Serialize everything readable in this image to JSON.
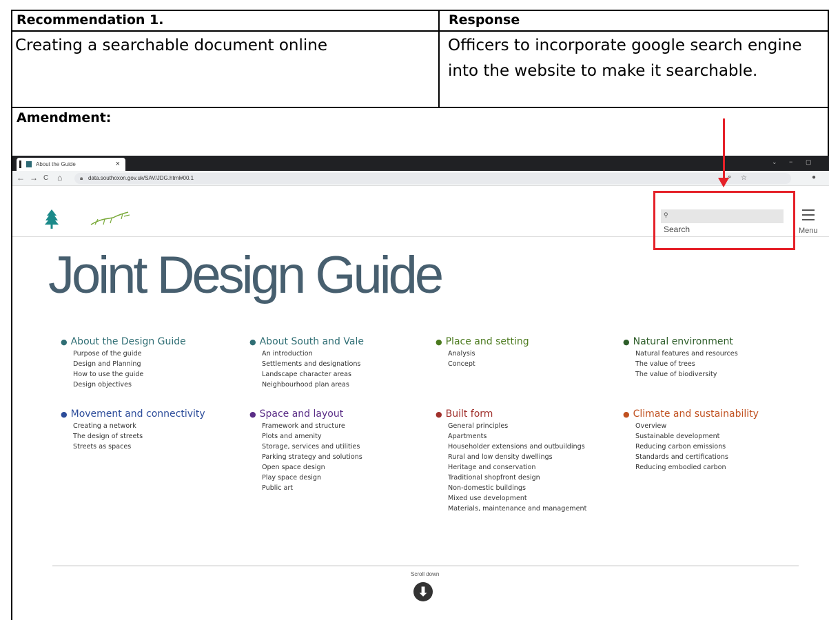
{
  "table": {
    "header_left": "Recommendation 1.",
    "header_right": "Response",
    "recommendation": "Creating a searchable document online",
    "response": "Officers to incorporate google search engine into the website to make it searchable.",
    "amendment_label": "Amendment:"
  },
  "browser": {
    "tab_title": "About the Guide",
    "tab_close": "×",
    "url": "data.southoxon.gov.uk/SAV/JDG.html#00.1",
    "back": "←",
    "forward": "→",
    "reload": "C",
    "home": "⌂",
    "share_icon": "⇗",
    "star_icon": "☆",
    "profile_icon": "●",
    "win_chevron": "⌄",
    "win_min": "−",
    "win_max": "▢"
  },
  "site": {
    "search_label": "Search",
    "search_icon": "⚲",
    "menu_label": "Menu",
    "title": "Joint Design Guide",
    "scroll_label": "Scroll down",
    "scroll_arrow": "⬇",
    "sections": [
      {
        "title": "About the Design Guide",
        "color": "#2f6e74",
        "items": [
          "Purpose of the guide",
          "Design and Planning",
          "How to use the guide",
          "Design objectives"
        ]
      },
      {
        "title": "About South and Vale",
        "color": "#2f6e74",
        "items": [
          "An introduction",
          "Settlements and designations",
          "Landscape character areas",
          "Neighbourhood plan areas"
        ]
      },
      {
        "title": "Place and setting",
        "color": "#4b7a1e",
        "items": [
          "Analysis",
          "Concept"
        ]
      },
      {
        "title": "Natural environment",
        "color": "#2e5e2a",
        "items": [
          "Natural features and resources",
          "The value of trees",
          "The value of biodiversity"
        ]
      },
      {
        "title": "Movement and connectivity",
        "color": "#2c4c9a",
        "items": [
          "Creating a network",
          "The design of streets",
          "Streets as spaces"
        ]
      },
      {
        "title": "Space and layout",
        "color": "#5a2d86",
        "items": [
          "Framework and structure",
          "Plots and amenity",
          "Storage, services and utilities",
          "Parking strategy and solutions",
          "Open space design",
          "Play space design",
          "Public art"
        ]
      },
      {
        "title": "Built form",
        "color": "#a0302c",
        "items": [
          "General principles",
          "Apartments",
          "Householder extensions and outbuildings",
          "Rural and low density dwellings",
          "Heritage and conservation",
          "Traditional shopfront design",
          "Non-domestic buildings",
          "Mixed use development",
          "Materials, maintenance and management"
        ]
      },
      {
        "title": "Climate and sustainability",
        "color": "#c0501f",
        "items": [
          "Overview",
          "Sustainable development",
          "Reducing carbon emissions",
          "Standards and certifications",
          "Reducing embodied carbon"
        ]
      }
    ]
  },
  "annotation_color": "#e52129"
}
